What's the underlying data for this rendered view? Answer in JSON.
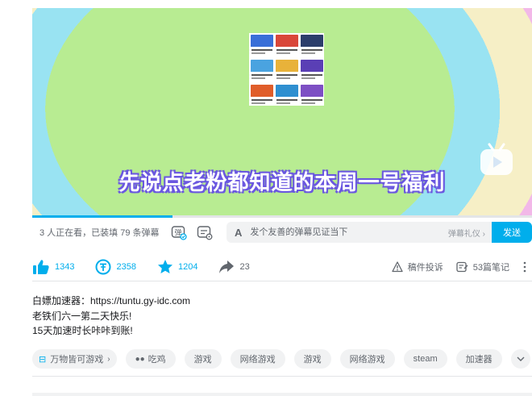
{
  "video": {
    "subtitle": "先说点老粉都知道的本周一号福利",
    "progress_fraction": 0.28,
    "thumb_colors": [
      "#3a6fd8",
      "#d9473a",
      "#2c3e6b",
      "#4aa3e0",
      "#e8b23a",
      "#5a3fb5",
      "#e05d2a",
      "#2f8fd0",
      "#7d4fc4"
    ]
  },
  "danmaku": {
    "stats": "3 人正在看，已装填 79 条弹幕",
    "toggle_icon_label": "弹",
    "placeholder": "发个友善的弹幕见证当下",
    "etiquette": "弹幕礼仪 ›",
    "send_label": "发送"
  },
  "toolbar": {
    "like_count": "1343",
    "coin_count": "2358",
    "fav_count": "1204",
    "share_count": "23",
    "report_label": "稿件投诉",
    "notes_label": "53篇笔记"
  },
  "description": {
    "lines": [
      "白嫖加速器：https://tuntu.gy-idc.com",
      "老铁们六一第二天快乐!",
      "15天加速时长咔咔到账!"
    ]
  },
  "tags": {
    "first": "万物皆可游戏",
    "items": [
      "吃鸡",
      "游戏",
      "网络游戏",
      "游戏",
      "网络游戏",
      "steam",
      "加速器"
    ]
  },
  "colors": {
    "accent": "#00aeec",
    "subtitle_outline": "#6b58e0"
  }
}
